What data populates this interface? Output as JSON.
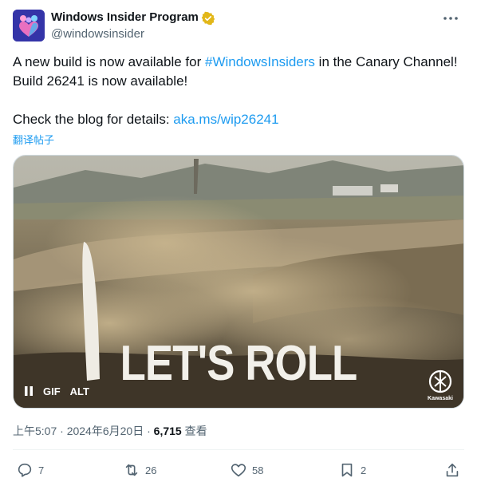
{
  "author": {
    "name": "Windows Insider Program",
    "handle": "@windowsinsider",
    "verified_color": "#e2b719",
    "avatar_icon": "people-heart-icon"
  },
  "tweet": {
    "line1_prefix": "A new build is now available for ",
    "hashtag": "#WindowsInsiders",
    "line1_suffix": " in the Canary Channel!  Build 26241 is now available!",
    "line2_prefix": "Check the blog for details:  ",
    "link": "aka.ms/wip26241",
    "translate": "翻译帖子"
  },
  "media": {
    "type": "GIF",
    "overlay_text": "LET'S ROLL",
    "gif_badge": "GIF",
    "alt_badge": "ALT",
    "brand_logo": "kawasaki-logo",
    "brand_text": "Kawasaki"
  },
  "meta": {
    "time": "上午5:07",
    "separator": " · ",
    "date": "2024年6月20日",
    "views": "6,715",
    "views_label": " 查看"
  },
  "actions": {
    "replies": "7",
    "reposts": "26",
    "likes": "58",
    "bookmarks": "2"
  },
  "colors": {
    "link": "#1d9bf0",
    "muted": "#536471",
    "text": "#0f1419"
  }
}
